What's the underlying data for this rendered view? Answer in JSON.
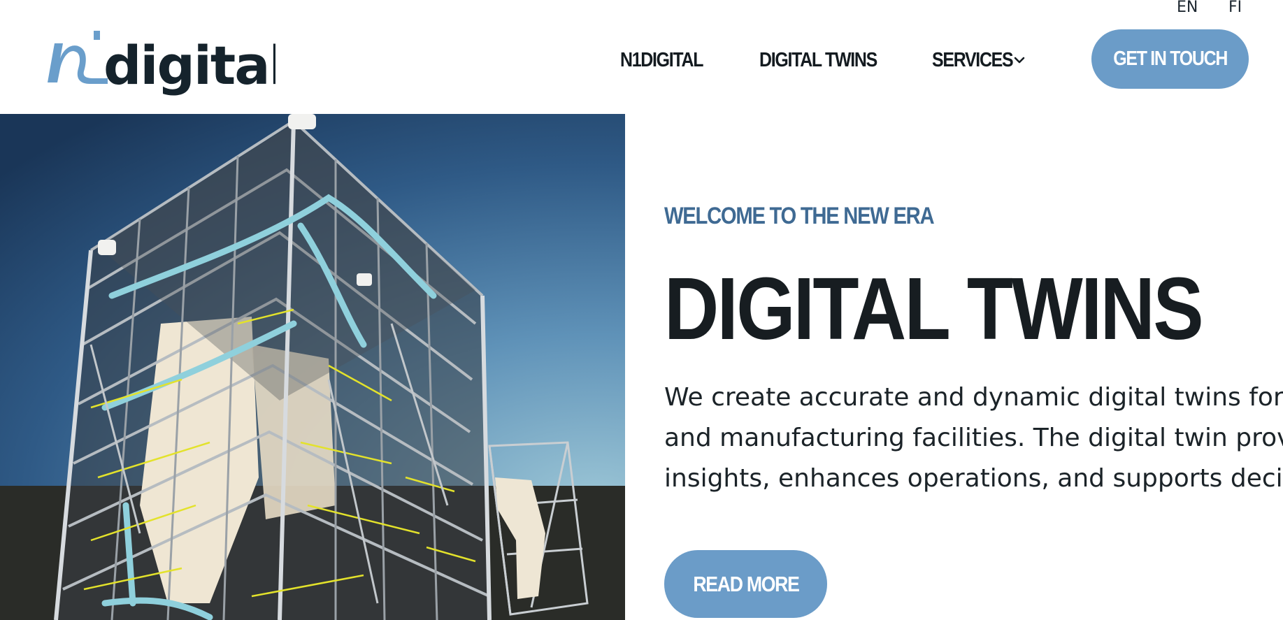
{
  "header": {
    "languages": [
      "EN",
      "FI"
    ],
    "logo_text": "n1digital",
    "nav": [
      {
        "label": "N1DIGITAL"
      },
      {
        "label": "DIGITAL TWINS"
      },
      {
        "label": "SERVICES",
        "has_dropdown": true
      }
    ],
    "cta_label": "GET IN TOUCH"
  },
  "hero": {
    "eyebrow": "WELCOME TO THE NEW ERA",
    "title": "DIGITAL TWINS",
    "description_lines": [
      "We create accurate and dynamic digital twins for pr",
      "and manufacturing facilities. The digital twin provide",
      "insights, enhances operations, and supports decisior"
    ],
    "read_more_label": "READ MORE"
  },
  "colors": {
    "accent": "#6b9cc8",
    "eyebrow": "#3f6a93",
    "text_dark": "#171d21",
    "background": "#ffffff"
  },
  "icons": {
    "services_dropdown": "chevron-down-icon"
  }
}
